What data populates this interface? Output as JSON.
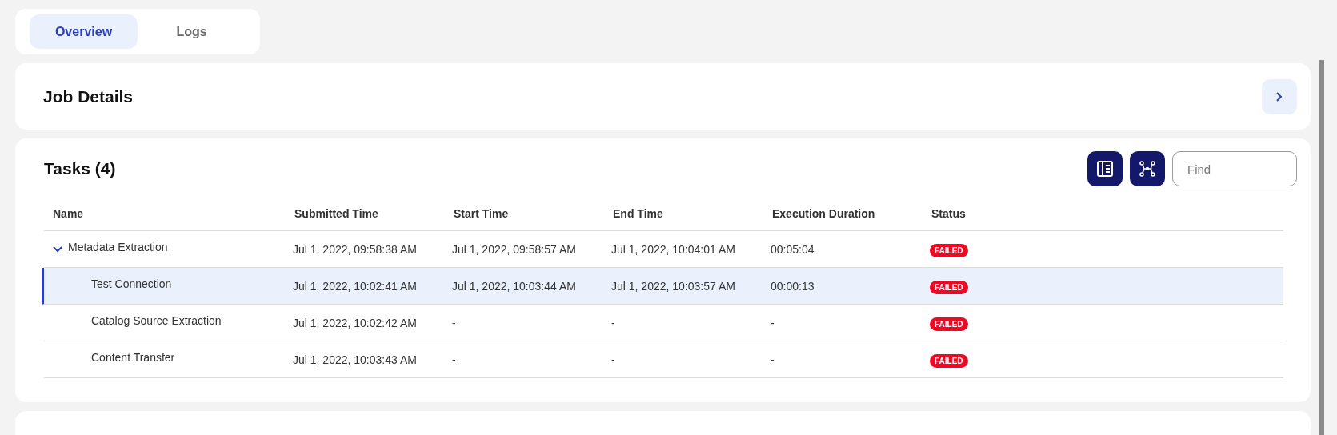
{
  "tabs": [
    {
      "label": "Overview",
      "selected": true
    },
    {
      "label": "Logs",
      "selected": false
    }
  ],
  "job_details": {
    "title": "Job Details"
  },
  "tasks": {
    "title": "Tasks (4)",
    "search": {
      "placeholder": "Find"
    },
    "columns": [
      "Name",
      "Submitted Time",
      "Start Time",
      "End Time",
      "Execution Duration",
      "Status"
    ],
    "rows": [
      {
        "name": "Metadata Extraction",
        "submitted": "Jul 1, 2022, 09:58:38 AM",
        "start": "Jul 1, 2022, 09:58:57 AM",
        "end": "Jul 1, 2022, 10:04:01 AM",
        "duration": "00:05:04",
        "status": "FAILED",
        "selected": false,
        "expanded": true,
        "children": [
          {
            "name": "Test Connection",
            "submitted": "Jul 1, 2022, 10:02:41 AM",
            "start": "Jul 1, 2022, 10:03:44 AM",
            "end": "Jul 1, 2022, 10:03:57 AM",
            "duration": "00:00:13",
            "status": "FAILED",
            "selected": true
          },
          {
            "name": "Catalog Source Extraction",
            "submitted": "Jul 1, 2022, 10:02:42 AM",
            "start": "-",
            "end": "-",
            "duration": "-",
            "status": "FAILED",
            "selected": false
          },
          {
            "name": "Content Transfer",
            "submitted": "Jul 1, 2022, 10:03:43 AM",
            "start": "-",
            "end": "-",
            "duration": "-",
            "status": "FAILED",
            "selected": false
          }
        ]
      }
    ]
  }
}
